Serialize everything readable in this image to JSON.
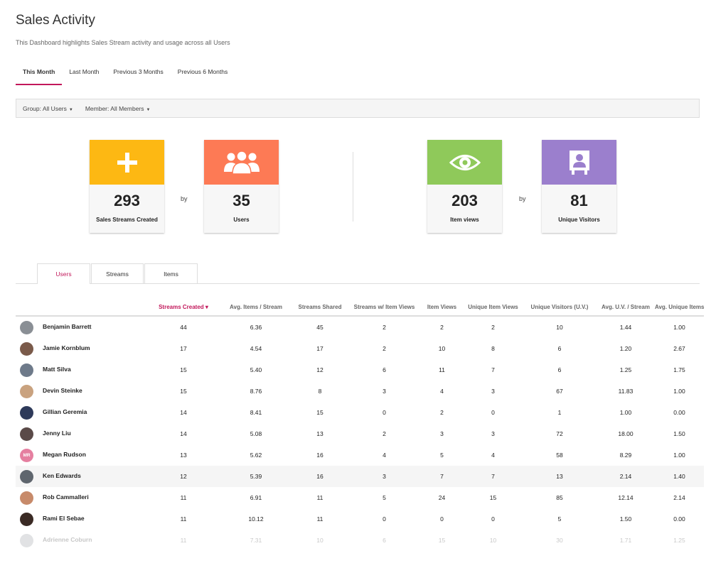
{
  "page": {
    "title": "Sales Activity",
    "subtitle": "This Dashboard highlights Sales Stream activity and usage across all Users"
  },
  "period_tabs": [
    "This Month",
    "Last Month",
    "Previous 3 Months",
    "Previous 6 Months"
  ],
  "filters": {
    "group": "Group: All Users",
    "member": "Member: All Members"
  },
  "connector": "by",
  "stats": [
    {
      "value": "293",
      "label": "Sales Streams Created",
      "color": "#fdb813",
      "icon": "plus-icon"
    },
    {
      "value": "35",
      "label": "Users",
      "color": "#fd7a55",
      "icon": "users-icon"
    },
    {
      "value": "203",
      "label": "Item views",
      "color": "#8fc95a",
      "icon": "eye-icon"
    },
    {
      "value": "81",
      "label": "Unique Visitors",
      "color": "#9b7fcd",
      "icon": "visitor-icon"
    }
  ],
  "section_tabs": [
    "Users",
    "Streams",
    "Items"
  ],
  "table": {
    "sort_indicator": "▾",
    "columns": [
      "Streams Created",
      "Avg. Items / Stream",
      "Streams Shared",
      "Streams w/ Item Views",
      "Item Views",
      "Unique Item Views",
      "Unique Visitors (U.V.)",
      "Avg. U.V. / Stream",
      "Avg. Unique Items"
    ],
    "rows": [
      {
        "name": "Benjamin Barrett",
        "avatar_color": "#8a8f95",
        "values": [
          "44",
          "6.36",
          "45",
          "2",
          "2",
          "2",
          "10",
          "1.44",
          "1.00"
        ]
      },
      {
        "name": "Jamie Kornblum",
        "avatar_color": "#7a5a4a",
        "values": [
          "17",
          "4.54",
          "17",
          "2",
          "10",
          "8",
          "6",
          "1.20",
          "2.67"
        ]
      },
      {
        "name": "Matt Silva",
        "avatar_color": "#6e7a8a",
        "values": [
          "15",
          "5.40",
          "12",
          "6",
          "11",
          "7",
          "6",
          "1.25",
          "1.75"
        ]
      },
      {
        "name": "Devin Steinke",
        "avatar_color": "#c9a27f",
        "values": [
          "15",
          "8.76",
          "8",
          "3",
          "4",
          "3",
          "67",
          "11.83",
          "1.00"
        ]
      },
      {
        "name": "Gillian Geremia",
        "avatar_color": "#2e3a5a",
        "values": [
          "14",
          "8.41",
          "15",
          "0",
          "2",
          "0",
          "1",
          "1.00",
          "0.00"
        ]
      },
      {
        "name": "Jenny Liu",
        "avatar_color": "#5a4a48",
        "values": [
          "14",
          "5.08",
          "13",
          "2",
          "3",
          "3",
          "72",
          "18.00",
          "1.50"
        ]
      },
      {
        "name": "Megan Rudson",
        "initials": "MR",
        "avatar_color": "#e57fa0",
        "values": [
          "13",
          "5.62",
          "16",
          "4",
          "5",
          "4",
          "58",
          "8.29",
          "1.00"
        ]
      },
      {
        "name": "Ken Edwards",
        "avatar_color": "#5f666e",
        "values": [
          "12",
          "5.39",
          "16",
          "3",
          "7",
          "7",
          "13",
          "2.14",
          "1.40"
        ]
      },
      {
        "name": "Rob Cammalleri",
        "avatar_color": "#c78a6a",
        "values": [
          "11",
          "6.91",
          "11",
          "5",
          "24",
          "15",
          "85",
          "12.14",
          "2.14"
        ]
      },
      {
        "name": "Rami El Sebae",
        "avatar_color": "#3a2a24",
        "values": [
          "11",
          "10.12",
          "11",
          "0",
          "0",
          "0",
          "5",
          "1.50",
          "0.00"
        ]
      },
      {
        "name": "Adrienne Coburn",
        "avatar_color": "#8a8f95",
        "values": [
          "11",
          "7.31",
          "10",
          "6",
          "15",
          "10",
          "30",
          "1.71",
          "1.25"
        ]
      }
    ]
  }
}
